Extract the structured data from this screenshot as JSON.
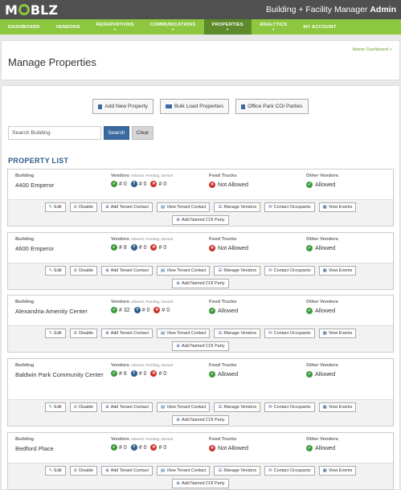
{
  "header": {
    "logo": [
      "M",
      "BLZ"
    ],
    "app_title": "Building + Facility Manager",
    "app_role": "Admin"
  },
  "nav": [
    {
      "label": "DASHBOARD",
      "caret": false,
      "active": false
    },
    {
      "label": "VENDORS",
      "caret": false,
      "active": false
    },
    {
      "label": "RESERVATIONS",
      "caret": true,
      "active": false
    },
    {
      "label": "COMMUNICATIONS",
      "caret": true,
      "active": false
    },
    {
      "label": "PROPERTIES",
      "caret": true,
      "active": true
    },
    {
      "label": "ANALYTICS",
      "caret": true,
      "active": false
    },
    {
      "label": "MY ACCOUNT",
      "caret": false,
      "active": false
    }
  ],
  "page": {
    "title": "Manage Properties",
    "breadcrumb": "Admin Dashboard »"
  },
  "toolbar": {
    "add_property": "Add New Property",
    "bulk_load": "Bulk Load Properties",
    "office_park": "Office Park COI Parties"
  },
  "search": {
    "placeholder": "Search Building",
    "search_label": "Search",
    "clear_label": "Clear"
  },
  "list_title": "PROPERTY LIST",
  "labels": {
    "building": "Building",
    "vendors": "Vendors",
    "vendors_sub": "Allowed, Pending, Denied",
    "food_trucks": "Food Trucks",
    "other_vendors": "Other Vendors"
  },
  "actions": {
    "edit": "Edit",
    "disable": "Disable",
    "add_tenant": "Add Tenant Contact",
    "view_tenant": "View Tenant Contact",
    "manage_vendors": "Manage Vendors",
    "contact_occupants": "Contact Occupants",
    "view_events": "View Events",
    "add_coi": "Add Named COI Party"
  },
  "properties": [
    {
      "name": "4400 Emperor",
      "allowed": "# 0",
      "pending": "# 0",
      "denied": "# 0",
      "food_trucks": "Not Allowed",
      "food_ok": false,
      "other_vendors": "Allowed",
      "other_ok": true
    },
    {
      "name": "4600 Emperor",
      "allowed": "# 8",
      "pending": "# 0",
      "denied": "# 0",
      "food_trucks": "Not Allowed",
      "food_ok": false,
      "other_vendors": "Allowed",
      "other_ok": true
    },
    {
      "name": "Alexandria Amenity Center",
      "allowed": "# 32",
      "pending": "# 0",
      "denied": "# 0",
      "food_trucks": "Allowed",
      "food_ok": true,
      "other_vendors": "Allowed",
      "other_ok": true
    },
    {
      "name": "Baldwin Park Community Center",
      "allowed": "# 6",
      "pending": "# 0",
      "denied": "# 0",
      "food_trucks": "Allowed",
      "food_ok": true,
      "other_vendors": "Allowed",
      "other_ok": true
    },
    {
      "name": "Bedford Place",
      "allowed": "# 0",
      "pending": "# 0",
      "denied": "# 0",
      "food_trucks": "Not Allowed",
      "food_ok": false,
      "other_vendors": "Allowed",
      "other_ok": true
    }
  ],
  "colors": {
    "brand_green": "#8dc63f",
    "nav_active": "#5d8a2a",
    "primary_blue": "#3a6aa0",
    "allowed_green": "#3d9a3d",
    "denied_red": "#c9302c"
  }
}
